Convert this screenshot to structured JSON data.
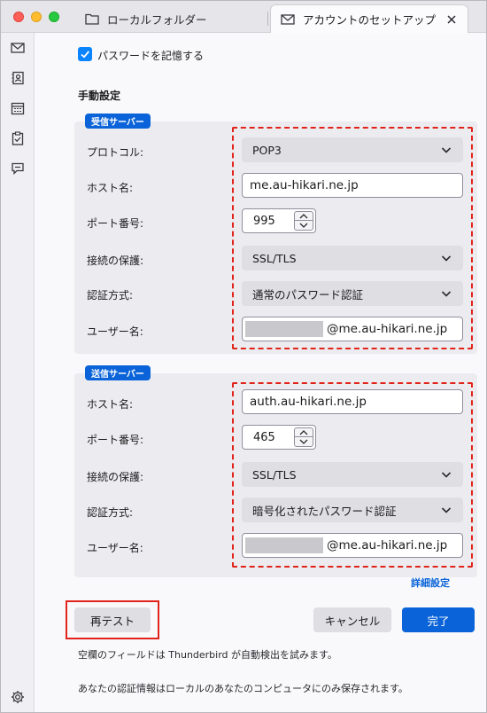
{
  "tabs": [
    {
      "label": "ローカルフォルダー",
      "icon": "folder-icon"
    },
    {
      "label": "アカウントのセットアップ",
      "icon": "mail-setup-icon"
    }
  ],
  "remember_password": {
    "label": "パスワードを記憶する",
    "checked": true
  },
  "manual": {
    "heading": "手動設定",
    "incoming": {
      "badge": "受信サーバー",
      "protocol_label": "プロトコル:",
      "protocol_value": "POP3",
      "host_label": "ホスト名:",
      "host_value": "me.au-hikari.ne.jp",
      "port_label": "ポート番号:",
      "port_value": "995",
      "security_label": "接続の保護:",
      "security_value": "SSL/TLS",
      "auth_label": "認証方式:",
      "auth_value": "通常のパスワード認証",
      "user_label": "ユーザー名:",
      "user_suffix": "@me.au-hikari.ne.jp"
    },
    "outgoing": {
      "badge": "送信サーバー",
      "host_label": "ホスト名:",
      "host_value": "auth.au-hikari.ne.jp",
      "port_label": "ポート番号:",
      "port_value": "465",
      "security_label": "接続の保護:",
      "security_value": "SSL/TLS",
      "auth_label": "認証方式:",
      "auth_value": "暗号化されたパスワード認証",
      "user_label": "ユーザー名:",
      "user_suffix": "@me.au-hikari.ne.jp"
    },
    "advanced_link": "詳細設定"
  },
  "buttons": {
    "retest": "再テスト",
    "cancel": "キャンセル",
    "done": "完了"
  },
  "notes": [
    "空欄のフィールドは Thunderbird が自動検出を試みます。",
    "あなたの認証情報はローカルのあなたのコンピュータにのみ保存されます。"
  ],
  "colors": {
    "accent": "#0a63d8",
    "highlight": "#e1241b"
  }
}
